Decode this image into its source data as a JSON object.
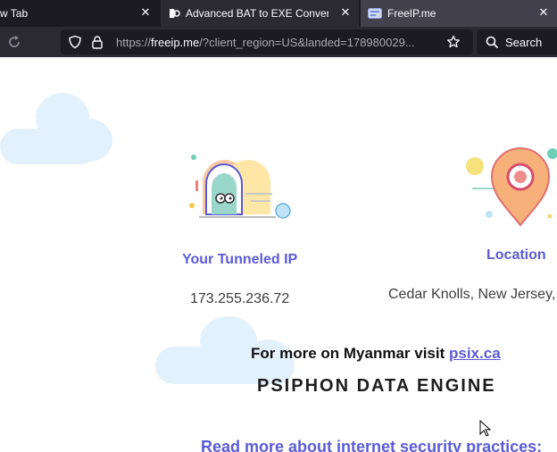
{
  "tabs": [
    {
      "label": "w Tab"
    },
    {
      "label": "Advanced BAT to EXE Converter"
    },
    {
      "label": "FreeIP.me"
    }
  ],
  "urlbar": {
    "prefix": "https://",
    "domain": "freeip.me",
    "rest": "/?client_region=US&landed=178980029..."
  },
  "search": {
    "label": "Search"
  },
  "page": {
    "ip_heading": "Your Tunneled IP",
    "ip_value": "173.255.236.72",
    "location_heading": "Location",
    "location_value": "Cedar Knolls, New Jersey,",
    "visit_prefix": "For more on Myanmar visit ",
    "visit_link": "psix.ca",
    "brand": "PSIPHON DATA ENGINE",
    "read_more": "Read more about internet security practices:"
  },
  "colors": {
    "accent": "#5b5bd6",
    "tabbar": "#1c1b22",
    "toolbar": "#2b2a33"
  }
}
